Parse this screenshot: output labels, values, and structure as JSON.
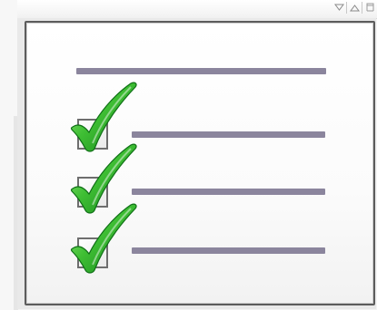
{
  "window": {
    "controls": [
      {
        "name": "menu-down-icon"
      },
      {
        "name": "menu-up-icon"
      },
      {
        "name": "restore-icon"
      }
    ]
  },
  "checklist": {
    "heading_line": true,
    "items": [
      {
        "checked": true
      },
      {
        "checked": true
      },
      {
        "checked": true
      }
    ]
  },
  "colors": {
    "line": "#8b859d",
    "check_dark": "#16861a",
    "check_light": "#7fe06f",
    "border": "#5c5c5c"
  }
}
